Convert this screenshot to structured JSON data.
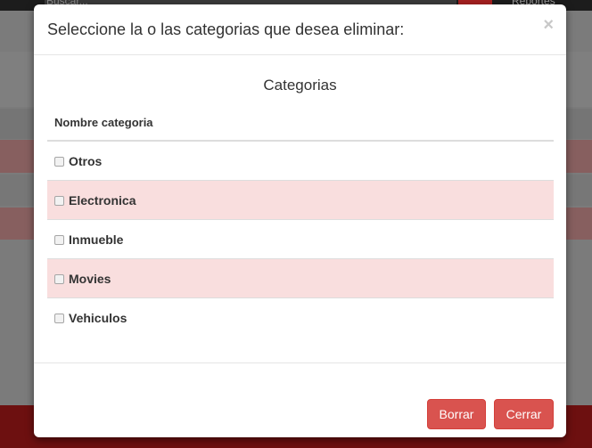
{
  "background": {
    "search_placeholder": "Buscar...",
    "reports_label": "Reportes",
    "accent_color": "#d9534f"
  },
  "modal": {
    "title": "Seleccione la o las categorias que desea eliminar:",
    "close_symbol": "×",
    "table_caption": "Categorias",
    "column_header": "Nombre categoria",
    "rows": [
      {
        "label": "Otros",
        "checked": false
      },
      {
        "label": "Electronica",
        "checked": false
      },
      {
        "label": "Inmueble",
        "checked": false
      },
      {
        "label": "Movies",
        "checked": false
      },
      {
        "label": "Vehiculos",
        "checked": false
      }
    ],
    "buttons": {
      "delete_label": "Borrar",
      "close_label": "Cerrar"
    }
  }
}
